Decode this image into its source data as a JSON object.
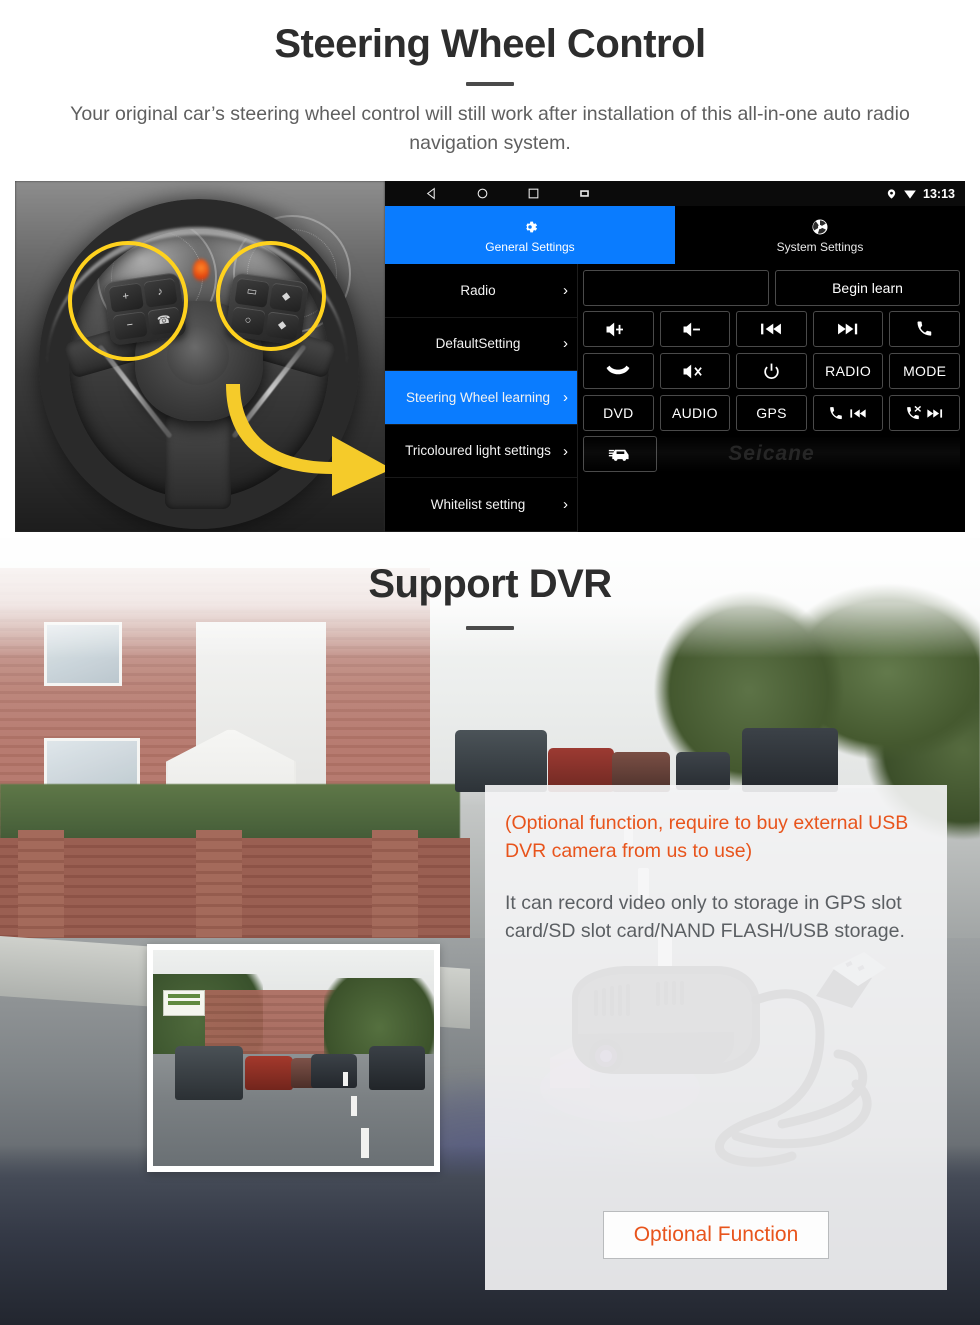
{
  "steering_section": {
    "title": "Steering Wheel Control",
    "subtitle": "Your original car’s steering wheel control will still work after installation of this all-in-one auto radio navigation system.",
    "photo_alt": "steering-wheel-photo"
  },
  "head_unit": {
    "status_bar": {
      "time": "13:13",
      "nav_icons": [
        "back-icon",
        "home-icon",
        "recents-icon",
        "screenshot-icon"
      ],
      "status_icons": [
        "location-pin-icon",
        "wifi-icon"
      ]
    },
    "tabs": [
      {
        "label": "General Settings",
        "icon": "gear-icon",
        "active": true
      },
      {
        "label": "System Settings",
        "icon": "system-settings-icon",
        "active": false
      }
    ],
    "menu_items": [
      {
        "label": "Radio",
        "selected": false
      },
      {
        "label": "DefaultSetting",
        "selected": false
      },
      {
        "label": "Steering Wheel learning",
        "selected": true
      },
      {
        "label": "Tricoloured light settings",
        "selected": false
      },
      {
        "label": "Whitelist setting",
        "selected": false
      }
    ],
    "display_value": "",
    "begin_learn_label": "Begin learn",
    "function_buttons": [
      {
        "label": "",
        "icon": "volume-up-icon"
      },
      {
        "label": "",
        "icon": "volume-down-icon"
      },
      {
        "label": "",
        "icon": "previous-track-icon"
      },
      {
        "label": "",
        "icon": "next-track-icon"
      },
      {
        "label": "",
        "icon": "call-answer-icon"
      },
      {
        "label": "",
        "icon": "call-hangup-icon"
      },
      {
        "label": "",
        "icon": "mute-icon"
      },
      {
        "label": "",
        "icon": "power-icon"
      },
      {
        "label": "RADIO",
        "icon": ""
      },
      {
        "label": "MODE",
        "icon": ""
      },
      {
        "label": "DVD",
        "icon": ""
      },
      {
        "label": "AUDIO",
        "icon": ""
      },
      {
        "label": "GPS",
        "icon": ""
      },
      {
        "label": "",
        "icon": "call-previous-icon"
      },
      {
        "label": "",
        "icon": "callend-next-icon"
      }
    ],
    "last_button": {
      "label": "",
      "icon": "vehicle-info-icon"
    },
    "watermark": "Seicane",
    "accent_color": "#0a7cff"
  },
  "dvr_section": {
    "title": "Support DVR",
    "note": "(Optional function, require to buy external USB DVR camera from us to use)",
    "description": "It can record video only to storage in GPS slot card/SD slot card/NAND FLASH/USB storage.",
    "optional_button_label": "Optional Function",
    "note_color": "#e8541c",
    "inset_alt": "dashcam-recording-thumbnail",
    "product_alt": "usb-dvr-camera-photo"
  }
}
